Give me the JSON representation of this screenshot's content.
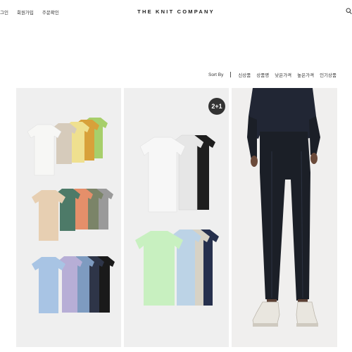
{
  "top_nav": {
    "login": "그인",
    "signup": "회원가입",
    "order": "주문확인"
  },
  "brand": {
    "name": "THE KNIT COMPANY"
  },
  "search": {
    "icon": "search-icon"
  },
  "sort": {
    "label": "Sort By",
    "options": [
      "신상품",
      "상품명",
      "낮은가격",
      "높은가격",
      "인기상품"
    ]
  },
  "products": [
    {
      "image": "tshirts-multicolor-stack",
      "colors": [
        "#f4f4f2",
        "#d6cbbb",
        "#efe08f",
        "#d8a13a",
        "#a7cf6b",
        "#e7cfb2",
        "#4d7a68",
        "#e58f6a",
        "#7b8468",
        "#9a9a9a",
        "#a8c4e4",
        "#b7aed6",
        "#7e9bc0",
        "#2e3548",
        "#1a1a1a"
      ]
    },
    {
      "image": "tshirts-2plus1",
      "badge": "2+1",
      "colors": [
        "#f5f5f5",
        "#e8e8e8",
        "#222222",
        "#c8f0c0",
        "#bcd3e6",
        "#d7d2c5",
        "#26304d"
      ]
    },
    {
      "image": "model-dark-slacks",
      "colors": [
        "#1b1f27",
        "#212634",
        "#e9e6df"
      ]
    }
  ]
}
